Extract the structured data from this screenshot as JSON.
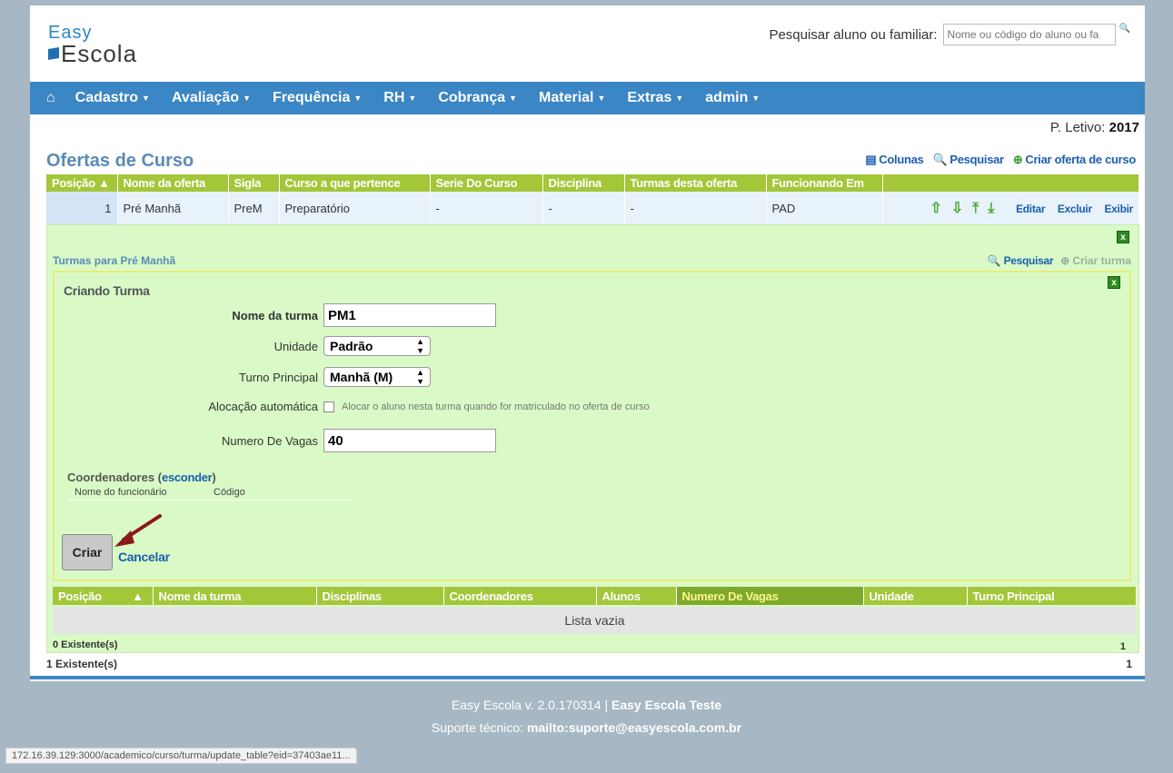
{
  "logo": {
    "line1": "Easy",
    "line2": "Escola"
  },
  "header": {
    "search_label": "Pesquisar aluno ou familiar:",
    "search_placeholder": "Nome ou código do aluno ou fa"
  },
  "nav": {
    "items": [
      "Cadastro",
      "Avaliação",
      "Frequência",
      "RH",
      "Cobrança",
      "Material",
      "Extras",
      "admin"
    ]
  },
  "periodo": {
    "label": "P. Letivo:",
    "value": "2017"
  },
  "section": {
    "title": "Ofertas de Curso",
    "actions": {
      "colunas": "Colunas",
      "pesquisar": "Pesquisar",
      "criar": "Criar oferta de curso"
    }
  },
  "main_table": {
    "headers": [
      "Posição",
      "Nome da oferta",
      "Sigla",
      "Curso a que pertence",
      "Serie Do Curso",
      "Disciplina",
      "Turmas desta oferta",
      "Funcionando Em"
    ],
    "row": {
      "posicao": "1",
      "nome": "Pré Manhã",
      "sigla": "PreM",
      "curso": "Preparatório",
      "serie": "-",
      "disciplina": "-",
      "turmas": "-",
      "funcionando": "PAD"
    },
    "row_actions": {
      "editar": "Editar",
      "excluir": "Excluir",
      "exibir": "Exibir"
    }
  },
  "nested": {
    "title": "Turmas para Pré Manhã",
    "pesquisar": "Pesquisar",
    "criar_turma": "Criar turma",
    "close": "x"
  },
  "form": {
    "title": "Criando Turma",
    "nome_label": "Nome da turma",
    "nome_value": "PM1",
    "unidade_label": "Unidade",
    "unidade_value": "Padrão",
    "turno_label": "Turno Principal",
    "turno_value": "Manhã (M)",
    "alocacao_label": "Alocação automática",
    "alocacao_hint": "Alocar o aluno nesta turma quando for matriculado no oferta de curso",
    "vagas_label": "Numero De Vagas",
    "vagas_value": "40",
    "coord_label": "Coordenadores (",
    "coord_link": "esconder",
    "coord_close": ")",
    "coord_col1": "Nome do funcionário",
    "coord_col2": "Código",
    "criar": "Criar",
    "cancelar": "Cancelar"
  },
  "sub_table": {
    "headers": [
      "Posição",
      "Nome da turma",
      "Disciplinas",
      "Coordenadores",
      "Alunos",
      "Numero De Vagas",
      "Unidade",
      "Turno Principal"
    ],
    "empty": "Lista vazia",
    "count": "0 Existente(s)",
    "page": "1"
  },
  "main_footer": {
    "count": "1 Existente(s)",
    "page": "1"
  },
  "footer": {
    "version": "Easy Escola v. 2.0.170314 |",
    "tenant": "Easy Escola Teste",
    "support_label": "Suporte técnico:",
    "support_link": "mailto:suporte@easyescola.com.br"
  },
  "statusbar": "172.16.39.129:3000/academico/curso/turma/update_table?eid=37403ae11...",
  "colors": {
    "nav": "#3b86c4",
    "table_header": "#a4c639",
    "nested_bg": "#d9fac6",
    "link": "#1b5fb0"
  }
}
